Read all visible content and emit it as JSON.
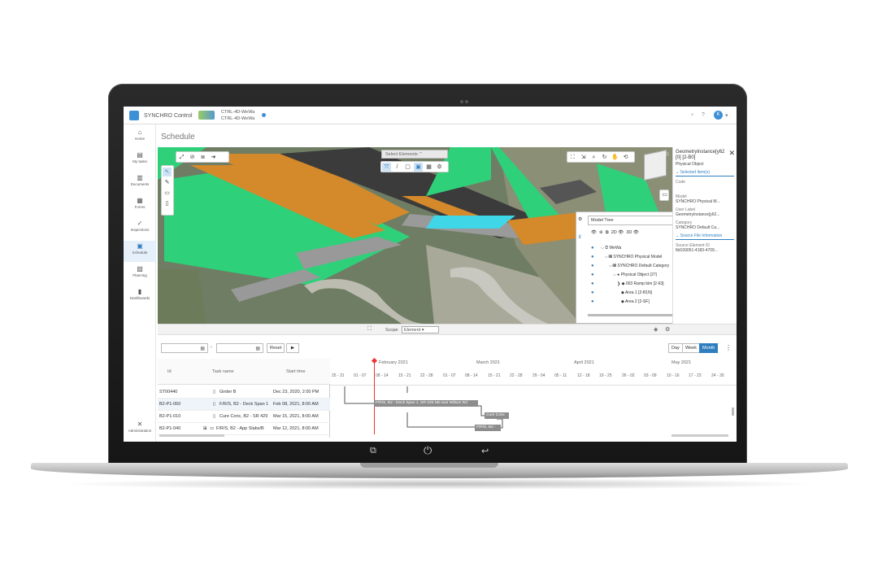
{
  "app": {
    "title": "SYNCHRO Control",
    "project_line1": "CTRL-4D-WeWa",
    "project_line2": "CTRL-4D-WeWa",
    "avatar": "K"
  },
  "sidebar": {
    "items": [
      {
        "label": "Home",
        "icon": "home-icon"
      },
      {
        "label": "My tasks",
        "icon": "tasks-icon"
      },
      {
        "label": "Documents",
        "icon": "documents-icon"
      },
      {
        "label": "Forms",
        "icon": "forms-icon"
      },
      {
        "label": "Inspections",
        "icon": "inspections-icon"
      },
      {
        "label": "Schedule",
        "icon": "schedule-icon"
      },
      {
        "label": "Planning",
        "icon": "planning-icon"
      },
      {
        "label": "Dashboards",
        "icon": "dashboards-icon"
      },
      {
        "label": "Administration",
        "icon": "administration-icon"
      }
    ]
  },
  "page": {
    "title": "Schedule"
  },
  "viewer": {
    "select_elements": "Select Elements",
    "model_tree": {
      "dropdown": "Model Tree",
      "toggle_2d": "2D",
      "toggle_3d": "3D",
      "rows": [
        "WeWa",
        "SYNCHRO Physical Model",
        "SYNCHRO Default Category",
        "Physical Object (27)",
        "003 Ramp bim [2-63]",
        "Area 1 [2-B1N]",
        "Area 2 [2-SF]"
      ]
    }
  },
  "properties": {
    "header": "GeometryInstance[y62 [0] [2-B0]",
    "subheader": "Physical Object",
    "section_selected": "Selected Item(s)",
    "code_label": "Code",
    "model_label": "Model",
    "model_value": "SYNCHRO Physical M...",
    "user_label_label": "User Label",
    "user_label_value": "GeometryInstance[y62...",
    "category_label": "Category",
    "category_value": "SYNCHRO Default Ca...",
    "section_source": "Source File Information",
    "source_label": "Source Element ID",
    "source_value": "8d169051-4183-4709..."
  },
  "midbar": {
    "scope_label": "Scope",
    "scope_value": "Element"
  },
  "gantt": {
    "date_sep": "-",
    "reset": "Reset",
    "views": [
      "Day",
      "Week",
      "Month"
    ],
    "headers": {
      "id": "Id",
      "task": "Task name",
      "start": "Start time"
    },
    "rows": [
      {
        "id": "ST00440",
        "name": "Girder B",
        "start": "Dec 23, 2020, 2:00 PM"
      },
      {
        "id": "B2-P1-050",
        "name": "F/R/S, B2 - Deck Span 1",
        "start": "Feb 08, 2021, 8:00 AM"
      },
      {
        "id": "B2-P1-010",
        "name": "Cure Conc, B2 - SR 429",
        "start": "Mar 15, 2021, 8:00 AM"
      },
      {
        "id": "B2-P1-040",
        "name": "F/R/S, B2 - App Slabs/B",
        "start": "Mar 12, 2021, 8:00 AM"
      }
    ],
    "months": [
      "February 2021",
      "March 2021",
      "April 2021",
      "May 2021"
    ],
    "weeks": [
      "25 - 31",
      "01 - 07",
      "08 - 14",
      "15 - 21",
      "22 - 28",
      "01 - 07",
      "08 - 14",
      "15 - 21",
      "22 - 28",
      "29 - 04",
      "05 - 11",
      "12 - 18",
      "19 - 25",
      "26 - 02",
      "03 - 09",
      "10 - 16",
      "17 - 23",
      "24 - 30"
    ],
    "bars": [
      {
        "label": "F/R/S, B2 - Deck Span 1, SR 429 SB over Wilson Rd"
      },
      {
        "label": "Cure Conc"
      },
      {
        "label": "F/R/S, B2 -"
      }
    ]
  },
  "colors": {
    "accent": "#2f7fc0",
    "green": "#2fd07a",
    "orange": "#d4892a",
    "cyan": "#3fd6e8"
  }
}
